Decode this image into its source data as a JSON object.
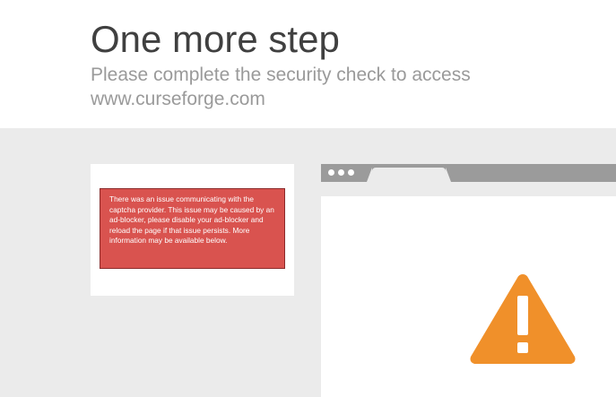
{
  "header": {
    "title": "One more step",
    "subtitle": "Please complete the security check to access www.curseforge.com"
  },
  "captcha": {
    "error_message": "There was an issue communicating with the captcha provider. This issue may be caused by an ad-blocker, please disable your ad-blocker and reload the page if that issue persists. More information may be available below."
  },
  "illustration": {
    "icon": "warning-icon",
    "accent_color": "#f0902a"
  },
  "colors": {
    "error_background": "#d9534f",
    "page_background": "#ebebeb",
    "browser_chrome": "#9b9b9b"
  }
}
